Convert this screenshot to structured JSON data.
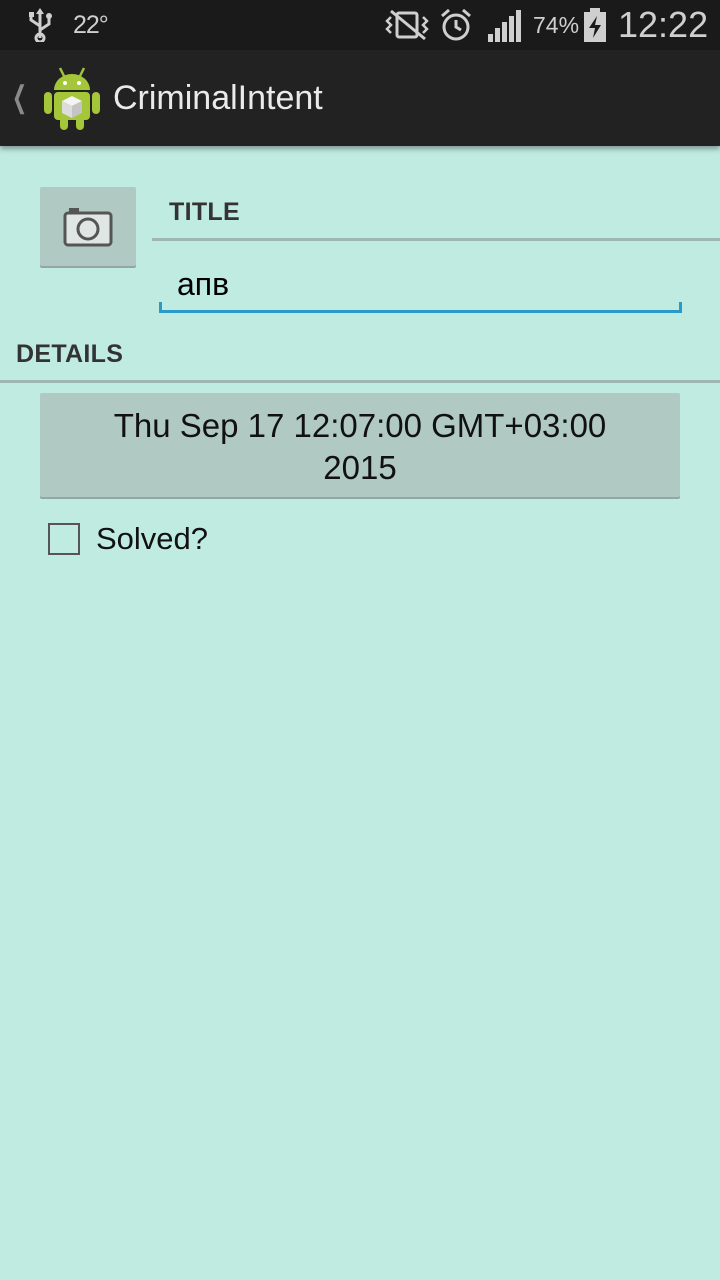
{
  "status_bar": {
    "temperature": "22°",
    "battery_percent": "74%",
    "time": "12:22",
    "icons": [
      "usb-icon",
      "mute-vibrate-icon",
      "alarm-icon",
      "signal-icon",
      "battery-charging-icon"
    ]
  },
  "action_bar": {
    "title": "CriminalIntent",
    "icons": [
      "up-caret-icon",
      "android-app-icon"
    ]
  },
  "crime_form": {
    "title_header": "TITLE",
    "title_value": "апв",
    "details_header": "DETAILS",
    "date_line1": "Thu Sep 17 12:07:00 GMT+03:00",
    "date_line2": "2015",
    "solved_label": "Solved?",
    "solved_checked": false,
    "photo_button_icon": "camera-icon"
  },
  "colors": {
    "background": "#c0ebe1",
    "action_bar": "#222222",
    "status_bar": "#1a1a1a",
    "button": "#b0c9c2",
    "input_underline": "#2a9bc9"
  }
}
